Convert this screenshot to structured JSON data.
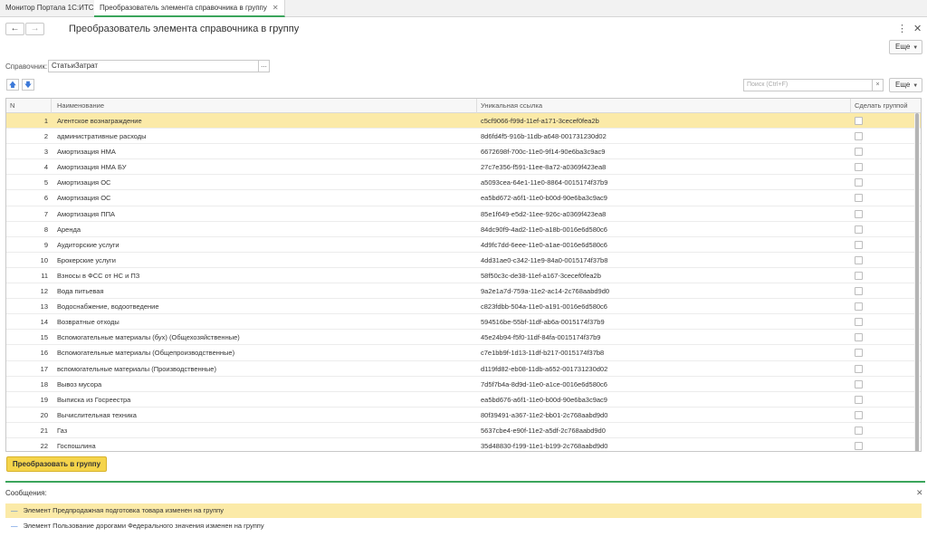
{
  "tabs": [
    {
      "label": "Монитор Портала 1С:ИТС"
    },
    {
      "label": "Преобразователь элемента справочника в группу"
    }
  ],
  "title": "Преобразователь элемента справочника в группу",
  "more_label": "Еще",
  "field": {
    "label": "Справочник:",
    "value": "СтатьиЗатрат",
    "choose": "..."
  },
  "search": {
    "placeholder": "Поиск (Ctrl+F)",
    "clear": "×"
  },
  "table": {
    "headers": {
      "n": "N",
      "name": "Наименование",
      "link": "Уникальная ссылка",
      "group": "Сделать группой"
    },
    "rows": [
      {
        "n": "1",
        "name": "Агентское вознаграждение",
        "link": "c5cf9066-f99d-11ef-a171-3cecef0fea2b"
      },
      {
        "n": "2",
        "name": "административные расходы",
        "link": "8d6fd4f5-916b-11db-a648-001731230d02"
      },
      {
        "n": "3",
        "name": "Амортизация НМА",
        "link": "6672698f-700c-11e0-9f14-90e6ba3c9ac9"
      },
      {
        "n": "4",
        "name": "Амортизация НМА БУ",
        "link": "27c7e356-f591-11ee-8a72-a0369f423ea8"
      },
      {
        "n": "5",
        "name": "Амортизация ОС",
        "link": "a5093cea-64e1-11e0-8864-0015174f37b9"
      },
      {
        "n": "6",
        "name": "Амортизация ОС",
        "link": "ea5bd672-a6f1-11e0-b00d-90e6ba3c9ac9"
      },
      {
        "n": "7",
        "name": "Амортизация ППА",
        "link": "85e1f649-e5d2-11ee-926c-a0369f423ea8"
      },
      {
        "n": "8",
        "name": "Аренда",
        "link": "84dc90f9-4ad2-11e0-a18b-0016e6d580c6"
      },
      {
        "n": "9",
        "name": "Аудиторские услуги",
        "link": "4d9fc7dd-6eee-11e0-a1ae-0016e6d580c6"
      },
      {
        "n": "10",
        "name": "Брокерские услуги",
        "link": "4dd31ae0-c342-11e9-84a0-0015174f37b8"
      },
      {
        "n": "11",
        "name": "Взносы в ФСС от НС и ПЗ",
        "link": "58f50c3c-de38-11ef-a167-3cecef0fea2b"
      },
      {
        "n": "12",
        "name": "Вода питьевая",
        "link": "9a2e1a7d-759a-11e2-ac14-2c768aabd9d0"
      },
      {
        "n": "13",
        "name": "Водоснабжение, водоотведение",
        "link": "c823fdbb-504a-11e0-a191-0016e6d580c6"
      },
      {
        "n": "14",
        "name": "Возвратные отходы",
        "link": "594516be-55bf-11df-ab6a-0015174f37b9"
      },
      {
        "n": "15",
        "name": "Вспомогательные материалы (бух) (Общехозяйственные)",
        "link": "45e24b94-f5f0-11df-84fa-0015174f37b9"
      },
      {
        "n": "16",
        "name": "Вспомогательные материалы (Общепроизводственные)",
        "link": "c7e1bb9f-1d13-11df-b217-0015174f37b8"
      },
      {
        "n": "17",
        "name": "вспомогательные материалы (Производственные)",
        "link": "d119fd82-eb08-11db-a652-001731230d02"
      },
      {
        "n": "18",
        "name": "Вывоз мусора",
        "link": "7d5f7b4a-8d9d-11e0-a1ce-0016e6d580c6"
      },
      {
        "n": "19",
        "name": "Выписка из Госреестра",
        "link": "ea5bd676-a6f1-11e0-b00d-90e6ba3c9ac9"
      },
      {
        "n": "20",
        "name": "Вычислительная техника",
        "link": "80f39491-a367-11e2-bb01-2c768aabd9d0"
      },
      {
        "n": "21",
        "name": "Газ",
        "link": "5637cbe4-e90f-11e2-a5df-2c768aabd9d0"
      },
      {
        "n": "22",
        "name": "Госпошлина",
        "link": "35d48830-f199-11e1-b199-2c768aabd9d0"
      }
    ]
  },
  "convert_label": "Преобразовать в группу",
  "messages": {
    "title": "Сообщения:",
    "items": [
      "Элемент Предпродажная подготовка товара изменен на группу",
      "Элемент Пользование дорогами Федерального значения изменен на группу"
    ]
  }
}
